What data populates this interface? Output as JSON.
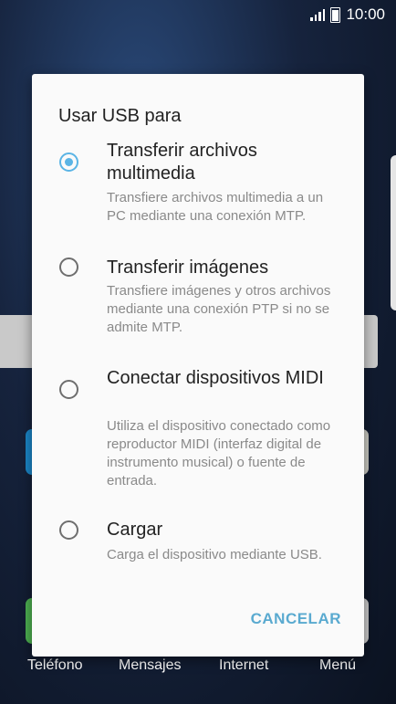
{
  "status_bar": {
    "time": "10:00",
    "signal_icon": "signal-icon",
    "battery_icon": "battery-icon"
  },
  "dialog": {
    "title": "Usar USB para",
    "options": [
      {
        "title": "Transferir archivos multimedia",
        "description": "Transfiere archivos multimedia a un PC mediante una conexión MTP.",
        "selected": true
      },
      {
        "title": "Transferir imágenes",
        "description": "Transfiere imágenes y otros archivos mediante una conexión PTP si no se admite MTP.",
        "selected": false
      },
      {
        "title": "Conectar dispositivos MIDI",
        "description": "Utiliza el dispositivo conectado como reproductor MIDI (interfaz digital de instrumento musical) o fuente de entrada.",
        "selected": false
      },
      {
        "title": "Cargar",
        "description": "Carga el dispositivo mediante USB.",
        "selected": false
      }
    ],
    "cancel_label": "CANCELAR",
    "accent_color": "#5ab4e5"
  },
  "dock": {
    "items": [
      {
        "label": "Teléfono"
      },
      {
        "label": "Mensajes"
      },
      {
        "label": "Internet"
      },
      {
        "label": "Menú"
      }
    ]
  }
}
